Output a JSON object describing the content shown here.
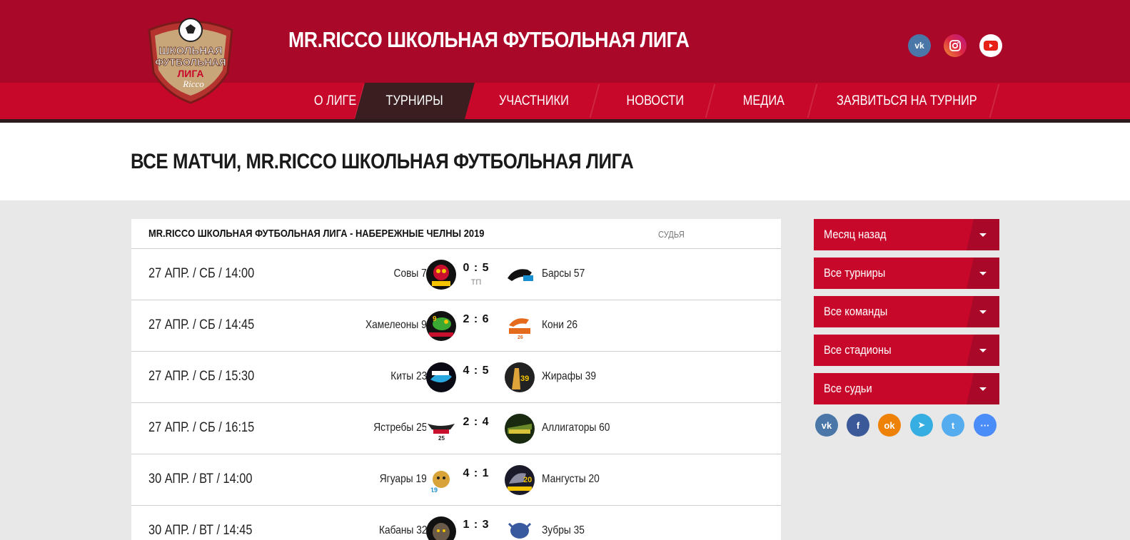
{
  "header": {
    "title": "MR.RICCO ШКОЛЬНАЯ ФУТБОЛЬНАЯ ЛИГА",
    "logo": {
      "line1": "ШКОЛЬНАЯ",
      "line2": "ФУТБОЛЬНАЯ",
      "line3": "ЛИГА",
      "brand": "Ricco"
    },
    "social": [
      {
        "name": "vk-icon",
        "text": "vk",
        "color": "#4a76a8"
      },
      {
        "name": "instagram-icon",
        "text": "",
        "color": "#e1306c"
      },
      {
        "name": "youtube-icon",
        "text": "",
        "color": "#ffffff"
      }
    ]
  },
  "nav": {
    "items": [
      {
        "label": "О ЛИГЕ"
      },
      {
        "label": "ТУРНИРЫ",
        "active": true
      },
      {
        "label": "УЧАСТНИКИ"
      },
      {
        "label": "НОВОСТИ"
      },
      {
        "label": "МЕДИА"
      },
      {
        "label": "ЗАЯВИТЬСЯ НА ТУРНИР"
      }
    ]
  },
  "page": {
    "title": "ВСЕ МАТЧИ, MR.RICCO ШКОЛЬНАЯ ФУТБОЛЬНАЯ ЛИГА"
  },
  "matches": {
    "league": "MR.RICCO ШКОЛЬНАЯ ФУТБОЛЬНАЯ ЛИГА - НАБЕРЕЖНЫЕ ЧЕЛНЫ 2019",
    "referee_label": "СУДЬЯ",
    "rows": [
      {
        "date": "27 АПР. / СБ / 14:00",
        "home": "Совы 7",
        "score": "0 : 5",
        "note": "ТП",
        "away": "Барсы 57"
      },
      {
        "date": "27 АПР. / СБ / 14:45",
        "home": "Хамелеоны 9",
        "score": "2 : 6",
        "note": "",
        "away": "Кони 26"
      },
      {
        "date": "27 АПР. / СБ / 15:30",
        "home": "Киты 23",
        "score": "4 : 5",
        "note": "",
        "away": "Жирафы 39"
      },
      {
        "date": "27 АПР. / СБ / 16:15",
        "home": "Ястребы 25",
        "score": "2 : 4",
        "note": "",
        "away": "Аллигаторы 60"
      },
      {
        "date": "30 АПР. / ВТ / 14:00",
        "home": "Ягуары 19",
        "score": "4 : 1",
        "note": "",
        "away": "Мангусты 20"
      },
      {
        "date": "30 АПР. / ВТ / 14:45",
        "home": "Кабаны 32",
        "score": "1 : 3",
        "note": "",
        "away": "Зубры 35"
      }
    ]
  },
  "filters": {
    "period": "Месяц назад",
    "tournaments": "Все турниры",
    "teams": "Все команды",
    "stadiums": "Все стадионы",
    "referees": "Все судьи"
  },
  "share": [
    {
      "name": "vk-share-icon",
      "text": "vk",
      "color": "#4a76a8"
    },
    {
      "name": "facebook-share-icon",
      "text": "f",
      "color": "#3b5998"
    },
    {
      "name": "odnoklassniki-share-icon",
      "text": "ok",
      "color": "#ee8208"
    },
    {
      "name": "telegram-share-icon",
      "text": "➤",
      "color": "#37aee2"
    },
    {
      "name": "twitter-share-icon",
      "text": "t",
      "color": "#55acee"
    },
    {
      "name": "more-share-icon",
      "text": "···",
      "color": "#4b8df8"
    }
  ]
}
